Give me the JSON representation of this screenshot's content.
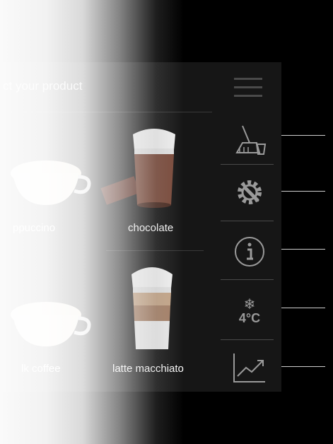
{
  "header": {
    "title": "ct your product"
  },
  "products": [
    {
      "label": "ppuccino"
    },
    {
      "label": "chocolate"
    },
    {
      "label": "lk coffee"
    },
    {
      "label": "latte macchiato"
    }
  ],
  "sidebar": {
    "items": [
      {
        "icon": "cleaning-icon"
      },
      {
        "icon": "settings-icon"
      },
      {
        "icon": "info-icon"
      },
      {
        "icon": "temperature-icon",
        "value": "4°C"
      },
      {
        "icon": "statistics-icon"
      }
    ]
  },
  "colors": {
    "screen": "#161616",
    "icon": "#9a9a9a",
    "callout": "#cfcfcf"
  }
}
